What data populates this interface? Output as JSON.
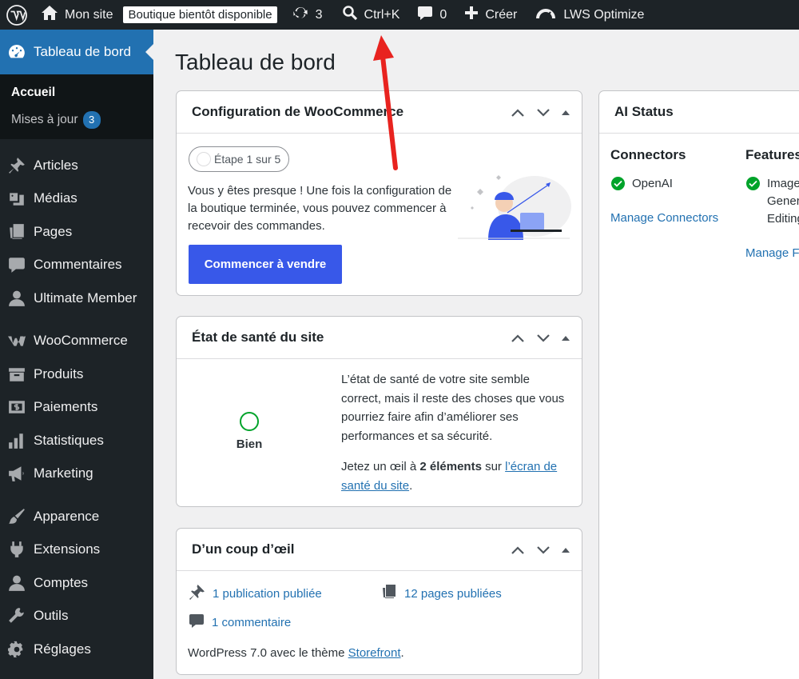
{
  "admin_bar": {
    "site_name": "Mon site",
    "store_badge": "Boutique bientôt disponible",
    "updates_count": "3",
    "search_shortcut": "Ctrl+K",
    "comments_count": "0",
    "new_label": "Créer",
    "optimize_label": "LWS Optimize"
  },
  "sidebar": {
    "dashboard": "Tableau de bord",
    "home": "Accueil",
    "updates": "Mises à jour",
    "updates_count": "3",
    "items": [
      {
        "label": "Articles",
        "icon": "pin-icon"
      },
      {
        "label": "Médias",
        "icon": "media-icon"
      },
      {
        "label": "Pages",
        "icon": "pages-icon"
      },
      {
        "label": "Commentaires",
        "icon": "comments-icon"
      },
      {
        "label": "Ultimate Member",
        "icon": "user-icon"
      },
      {
        "label": "WooCommerce",
        "icon": "woocommerce-icon"
      },
      {
        "label": "Produits",
        "icon": "archive-icon"
      },
      {
        "label": "Paiements",
        "icon": "money-icon"
      },
      {
        "label": "Statistiques",
        "icon": "chart-icon"
      },
      {
        "label": "Marketing",
        "icon": "megaphone-icon"
      },
      {
        "label": "Apparence",
        "icon": "brush-icon"
      },
      {
        "label": "Extensions",
        "icon": "plugin-icon"
      },
      {
        "label": "Comptes",
        "icon": "users-icon"
      },
      {
        "label": "Outils",
        "icon": "wrench-icon"
      },
      {
        "label": "Réglages",
        "icon": "settings-icon"
      }
    ]
  },
  "page": {
    "title": "Tableau de bord"
  },
  "woo_setup": {
    "title": "Configuration de WooCommerce",
    "step": "Étape 1 sur 5",
    "text": "Vous y êtes presque ! Une fois la configuration de la boutique terminée, vous pouvez commencer à recevoir des commandes.",
    "button": "Commencer à vendre"
  },
  "site_health": {
    "title": "État de santé du site",
    "status": "Bien",
    "text": "L’état de santé de votre site semble correct, mais il reste des choses que vous pourriez faire afin d’améliorer ses performances et sa sécurité.",
    "items_prefix": "Jetez un œil à ",
    "items_count": "2 éléments",
    "items_mid": " sur ",
    "link": "l’écran de santé du site",
    "items_suffix": "."
  },
  "glance": {
    "title": "D’un coup d’œil",
    "posts": "1 publication publiée",
    "pages": "12 pages publiées",
    "comments": "1 commentaire",
    "footer_prefix": "WordPress 7.0 avec le thème ",
    "theme": "Storefront",
    "footer_suffix": "."
  },
  "ai_status": {
    "title": "AI Status",
    "connectors_title": "Connectors",
    "connector": "OpenAI",
    "manage_connectors": "Manage Connectors",
    "features_title": "Features",
    "feature_line1": "Image",
    "feature_line2": "Gener",
    "feature_line3": "Editing",
    "manage_features": "Manage F"
  },
  "colors": {
    "admin_bar": "#1d2327",
    "accent": "#2271b1",
    "woo_button": "#3858e9",
    "success": "#00a32a",
    "annotation_arrow": "#e8231f"
  }
}
